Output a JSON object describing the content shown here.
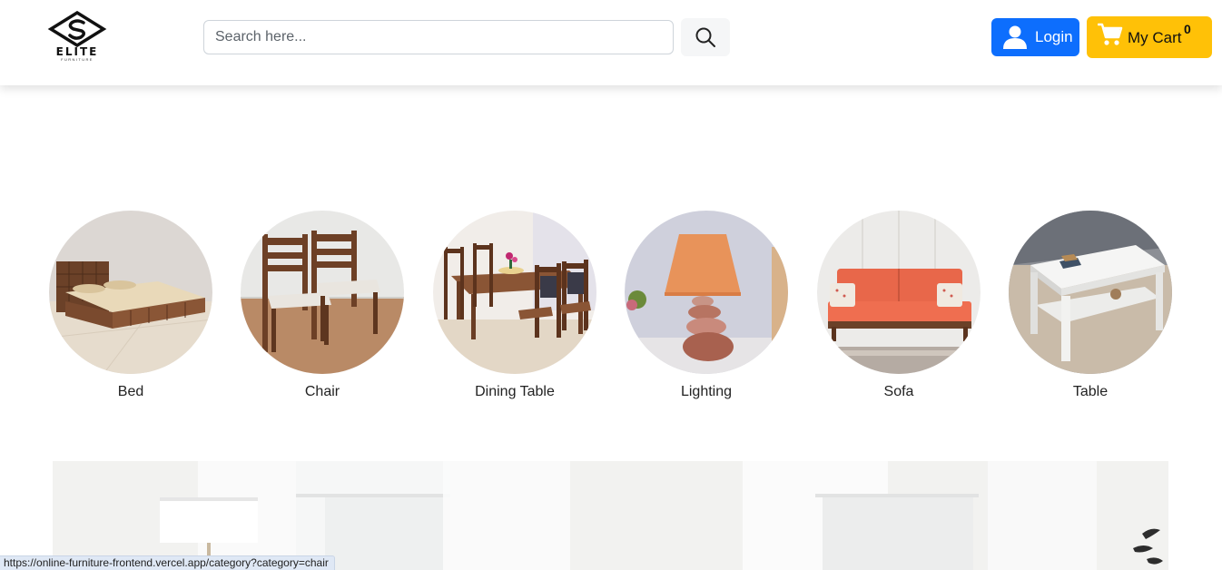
{
  "brand": {
    "name": "ELITE",
    "tagline": "FURNITURE"
  },
  "search": {
    "placeholder": "Search here...",
    "value": ""
  },
  "auth": {
    "login_label": "Login"
  },
  "cart": {
    "label": "My Cart",
    "count": "0"
  },
  "categories": [
    {
      "label": "Bed"
    },
    {
      "label": "Chair"
    },
    {
      "label": "Dining Table"
    },
    {
      "label": "Lighting"
    },
    {
      "label": "Sofa"
    },
    {
      "label": "Table"
    }
  ],
  "status_bar": {
    "url": "https://online-furniture-frontend.vercel.app/category?category=chair"
  },
  "colors": {
    "primary": "#0d6efd",
    "warning": "#ffc107",
    "text": "#222222"
  },
  "icons": {
    "search": "search-icon",
    "user": "user-icon",
    "cart": "cart-icon"
  }
}
